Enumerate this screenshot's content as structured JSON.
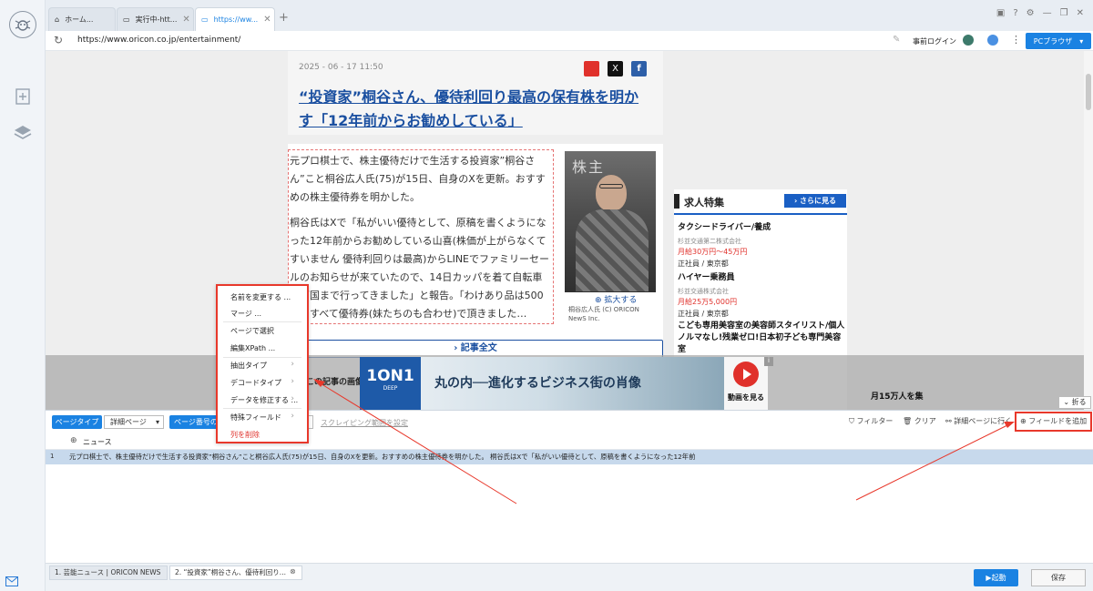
{
  "tabs": [
    {
      "label": "ホーム..."
    },
    {
      "label": "実行中-htt..."
    },
    {
      "label": "https://ww..."
    }
  ],
  "address": {
    "url": "https://www.oricon.co.jp/entertainment/",
    "login_label": "事前ログイン",
    "browser_mode": "PCブラウザ"
  },
  "article": {
    "date": "2025 - 06 - 17 11:50",
    "title": "“投資家”桐谷さん、優待利回り最高の保有株を明かす「12年前からお勧めしている」",
    "para1": "元プロ棋士で、株主優待だけで生活する投資家”桐谷さん”こと桐谷広人氏(75)が15日、自身のXを更新。おすすめの株主優待券を明かした。",
    "para2": "桐谷氏はXで「私がいい優待として、原稿を書くようになった12年前からお勧めしている山喜(株価が上がらなくてすいません 優待利回りは最高)からLINEでファミリーセールのお知らせが来ていたので、14日カッパを着て自転車で両国まで行ってきました」と報告。「わけあり品は500円。すべて優待券(妹たちのも合わせ)で頂きました…",
    "zoom_label": "拡大する",
    "caption": "桐谷広人氏 (C) ORICON NewS Inc.",
    "fulltext_label": "記事全文",
    "image_heading": "この記事の画像"
  },
  "jobs": {
    "title": "求人特集",
    "more_label": "さらに見る",
    "items": [
      {
        "title": "タクシードライバー/養成",
        "company": "杉並交通第二株式会社",
        "salary": "月給30万円〜45万円",
        "type": "正社員 / 東京都"
      },
      {
        "title": "ハイヤー乗務員",
        "company": "杉並交通株式会社",
        "salary": "月給25万5,000円",
        "type": "正社員 / 東京都"
      },
      {
        "title": "こども専用美容室の美容師スタイリスト/個人ノルマなし!残業ゼロ!日本初子ども専門美容室",
        "company": "",
        "salary": "",
        "type": ""
      }
    ],
    "partial_text": "月15万人を集"
  },
  "ad": {
    "logo_top": "1ON1",
    "logo_sub": "DEEP",
    "headline": "丸の内──進化するビジネス街の肖像",
    "video_label": "動画を見る"
  },
  "fold_label": "折る",
  "context_menu": {
    "items": [
      {
        "label": "名前を変更する ..."
      },
      {
        "label": "マージ ..."
      },
      {
        "label": "ページで選択"
      },
      {
        "label": "編集XPath ..."
      },
      {
        "label": "抽出タイプ"
      },
      {
        "label": "デコードタイプ"
      },
      {
        "label": "データを修正する ..."
      },
      {
        "label": "特殊フィールド"
      },
      {
        "label": "列を削除"
      }
    ]
  },
  "panel": {
    "page_type_label": "ページタイプ",
    "page_type_value": "詳細ページ",
    "page_num_label": "ページ番号の",
    "scrape_range_label": "スクレイピング範囲を設定",
    "filter_label": "フィルター",
    "clear_label": "クリア",
    "detail_label": "詳細ページに行く",
    "add_field_label": "フィールドを追加",
    "column_header": "ニュース",
    "rows": [
      {
        "num": "1",
        "text": "元プロ棋士で、株主優待だけで生活する投資家”桐谷さん”こと桐谷広人氏(75)が15日、自身のXを更新。おすすめの株主優待券を明かした。 桐谷氏はXで「私がいい優待として、原稿を書くようになった12年前"
      }
    ]
  },
  "status": {
    "tab1": "1. 芸能ニュース | ORICON NEWS",
    "tab2": "2. “投資家”桐谷さん、優待利回り...",
    "start_label": "起動",
    "save_label": "保存"
  },
  "colors": {
    "accent": "#1a82e2",
    "highlight_red": "#e8382b",
    "link": "#1a4fa0"
  }
}
